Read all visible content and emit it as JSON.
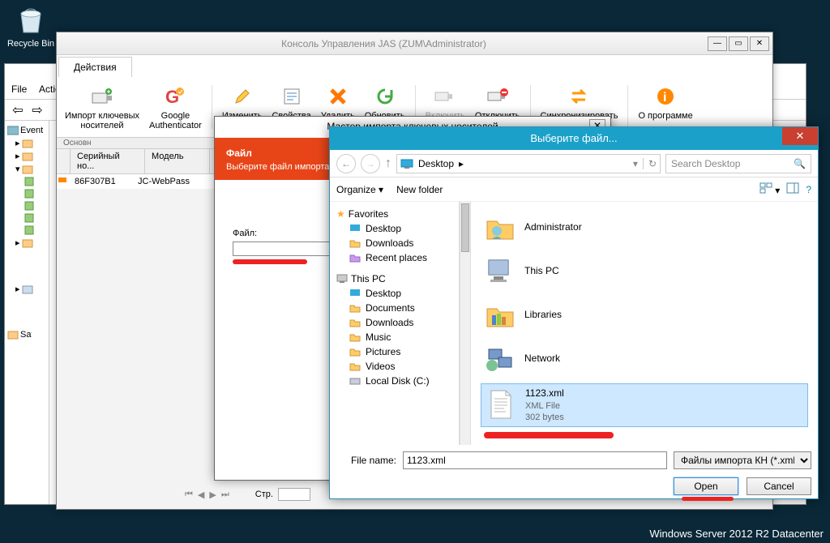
{
  "desktop": {
    "recycle": "Recycle Bin"
  },
  "evtvwr": {
    "menu": {
      "file": "File",
      "action": "Action"
    },
    "tree_root": "Event Viewer",
    "tree_saved": "Saved Logs"
  },
  "jas": {
    "title": "Консоль Управления JAS (ZUM\\Administrator)",
    "tab": "Действия",
    "ribbon": {
      "import": "Импорт ключевых\nносителей",
      "google": "Google\nAuthenticator",
      "edit": "Изменить",
      "props": "Свойства",
      "delete": "Удалить",
      "refresh": "Обновить",
      "enable": "Включить",
      "disable": "Отключить",
      "sync": "Синхронизировать",
      "about": "О программе"
    },
    "ribbon_footer": "Основн",
    "grid": {
      "col_serial": "Серийный но...",
      "col_model": "Модель",
      "row_serial": "86F307B1",
      "row_model": "JC-WebPass"
    },
    "pager": {
      "label": "Стр."
    }
  },
  "wizard": {
    "title": "Мастер импорта ключевых носителей",
    "header": "Файл",
    "subheader": "Выберите файл импорта",
    "file_label": "Файл:"
  },
  "filedlg": {
    "title": "Выберите файл...",
    "crumb": "Desktop",
    "search_placeholder": "Search Desktop",
    "organize": "Organize",
    "newfolder": "New folder",
    "sidebar": {
      "favorites": "Favorites",
      "desktop": "Desktop",
      "downloads": "Downloads",
      "recent": "Recent places",
      "thispc": "This PC",
      "desktop2": "Desktop",
      "documents": "Documents",
      "downloads2": "Downloads",
      "music": "Music",
      "pictures": "Pictures",
      "videos": "Videos",
      "localdisk": "Local Disk (C:)"
    },
    "content": {
      "admin": "Administrator",
      "thispc": "This PC",
      "libraries": "Libraries",
      "network": "Network",
      "file_name": "1123.xml",
      "file_type": "XML File",
      "file_size": "302 bytes"
    },
    "footer": {
      "filename_label": "File name:",
      "filename_value": "1123.xml",
      "filter": "Файлы импорта КН (*.xml)",
      "open": "Open",
      "cancel": "Cancel"
    }
  },
  "watermark": "Windows Server 2012 R2 Datacenter"
}
